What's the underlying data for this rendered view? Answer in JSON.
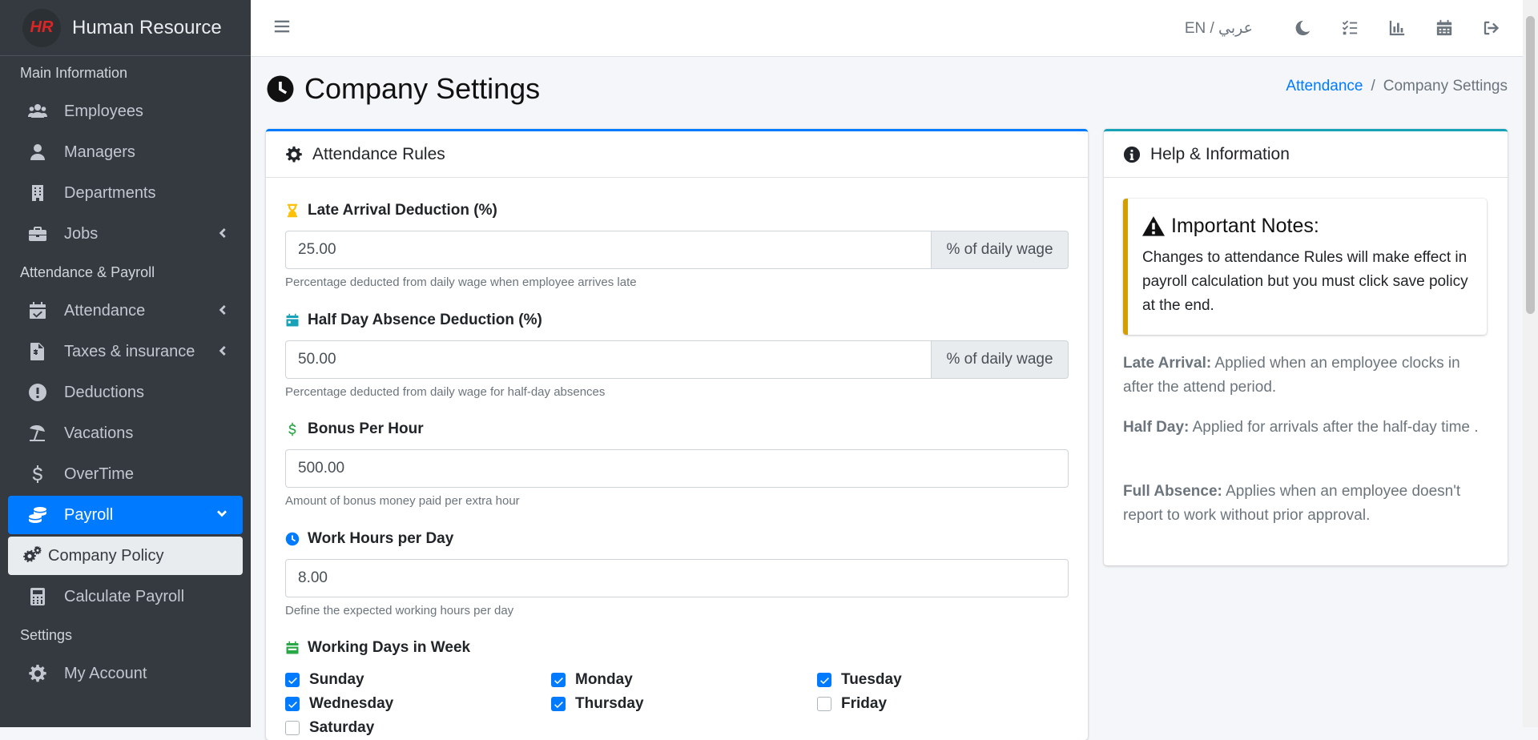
{
  "brand": {
    "logo_text": "HR",
    "name": "Human Resource"
  },
  "sidebar": {
    "section_main": "Main Information",
    "section_attendance": "Attendance & Payroll",
    "section_settings": "Settings",
    "items": {
      "employees": "Employees",
      "managers": "Managers",
      "departments": "Departments",
      "jobs": "Jobs",
      "attendance": "Attendance",
      "taxes": "Taxes & insurance",
      "deductions": "Deductions",
      "vacations": "Vacations",
      "overtime": "OverTime",
      "payroll": "Payroll",
      "company_policy": "Company Policy",
      "calculate_payroll": "Calculate Payroll",
      "my_account": "My Account"
    }
  },
  "topbar": {
    "language": "EN / عربي"
  },
  "page": {
    "title": "Company Settings"
  },
  "breadcrumb": {
    "parent": "Attendance",
    "separator": "/",
    "current": "Company Settings"
  },
  "rules_card": {
    "title": "Attendance Rules",
    "late": {
      "label": "Late Arrival Deduction (%)",
      "value": "25.00",
      "addon": "% of daily wage",
      "help": "Percentage deducted from daily wage when employee arrives late"
    },
    "half_day": {
      "label": "Half Day Absence Deduction (%)",
      "value": "50.00",
      "addon": "% of daily wage",
      "help": "Percentage deducted from daily wage for half-day absences"
    },
    "bonus": {
      "label": "Bonus Per Hour",
      "value": "500.00",
      "help": "Amount of bonus money paid per extra hour"
    },
    "hours": {
      "label": "Work Hours per Day",
      "value": "8.00",
      "help": "Define the expected working hours per day"
    },
    "days_label": "Working Days in Week",
    "days": [
      {
        "name": "Sunday",
        "checked": true
      },
      {
        "name": "Monday",
        "checked": true
      },
      {
        "name": "Tuesday",
        "checked": true
      },
      {
        "name": "Wednesday",
        "checked": true
      },
      {
        "name": "Thursday",
        "checked": true
      },
      {
        "name": "Friday",
        "checked": false
      },
      {
        "name": "Saturday",
        "checked": false
      }
    ]
  },
  "help_card": {
    "title": "Help & Information",
    "note_title": "Important Notes:",
    "note_body": "Changes to attendance Rules will make effect in payroll calculation but you must click save policy at the end.",
    "late_term": "Late Arrival:",
    "late_desc": " Applied when an employee clocks in after the attend period.",
    "half_term": "Half Day:",
    "half_desc": " Applied for arrivals after the half-day time .",
    "full_term": "Full Absence:",
    "full_desc": " Applies when an employee doesn't report to work without prior approval."
  },
  "colors": {
    "primary": "#007bff",
    "sidebar": "#343a40",
    "info": "#17a2b8",
    "warning": "#d39e00",
    "danger_logo": "#e02424"
  }
}
